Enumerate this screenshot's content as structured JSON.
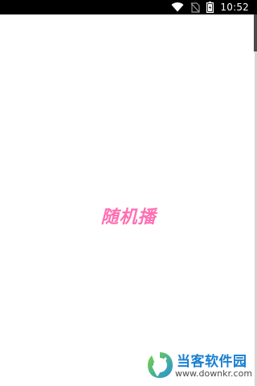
{
  "status_bar": {
    "time": "10:52",
    "icons": [
      "wifi-icon",
      "no-sim-icon",
      "battery-icon"
    ]
  },
  "splash": {
    "title": "随机播",
    "title_color": "#ff6fb3"
  },
  "watermark": {
    "brand": "当客软件园",
    "url": "www.downkr.com",
    "brand_color": "#1a7fd0"
  }
}
